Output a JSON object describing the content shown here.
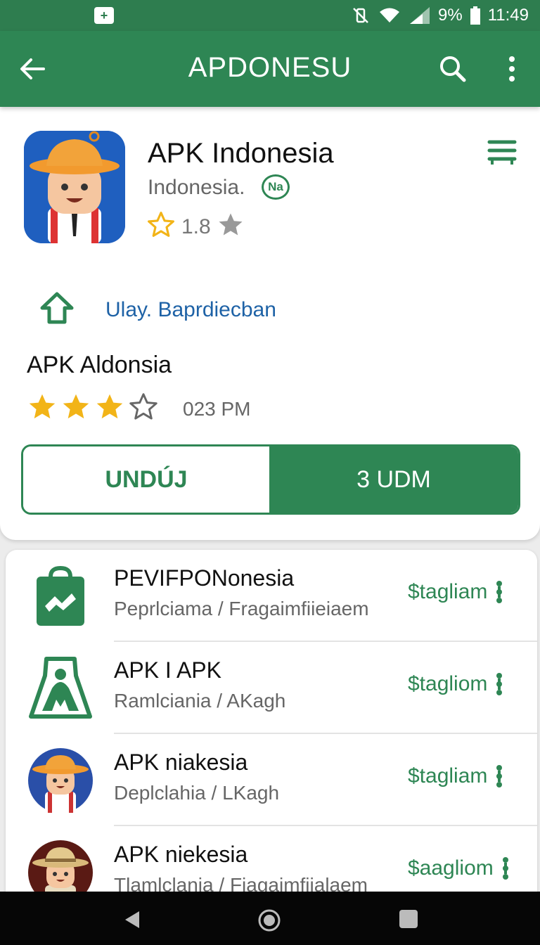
{
  "status_bar": {
    "notification_glyph": "+",
    "battery": "9%",
    "time": "11:49"
  },
  "app_bar": {
    "title": "APDONESU",
    "icons": [
      "back-arrow-icon",
      "search-icon",
      "more-vert-icon"
    ]
  },
  "app": {
    "name": "APK Indonesia",
    "developer": "Indonesia.",
    "badge": "Na",
    "rating": "1.8",
    "link_text": "Ulay. Baprdiecban",
    "sub_title": "APK Aldonsia",
    "stars_filled": 3,
    "stars_total": 4,
    "time": "023 PM"
  },
  "buttons": {
    "outline_label": "UNDÚJ",
    "fill_label": "3 UDM"
  },
  "list": {
    "items": [
      {
        "name": "PEVIFPONonesia",
        "sub": "Peprlciama / Fragaimfiieiaem",
        "action": "$tagliam",
        "icon": "green-bag-icon"
      },
      {
        "name": "APK I APK",
        "sub": "Ramlciania / AKagh",
        "action": "$tagliom",
        "icon": "green-shield-icon"
      },
      {
        "name": "APK niakesia",
        "sub": "Deplclahia / LKagh",
        "action": "$tagliam",
        "icon": "explorer-avatar-icon"
      },
      {
        "name": "APK niekesia",
        "sub": "Tlamlclania / Fiagaimfiialaem",
        "action": "$aagliom",
        "icon": "safari-avatar-icon"
      }
    ]
  },
  "colors": {
    "primary": "#2e8654",
    "status_bar": "#2e7d4f",
    "link": "#1e62a6",
    "star": "#f2b418"
  }
}
